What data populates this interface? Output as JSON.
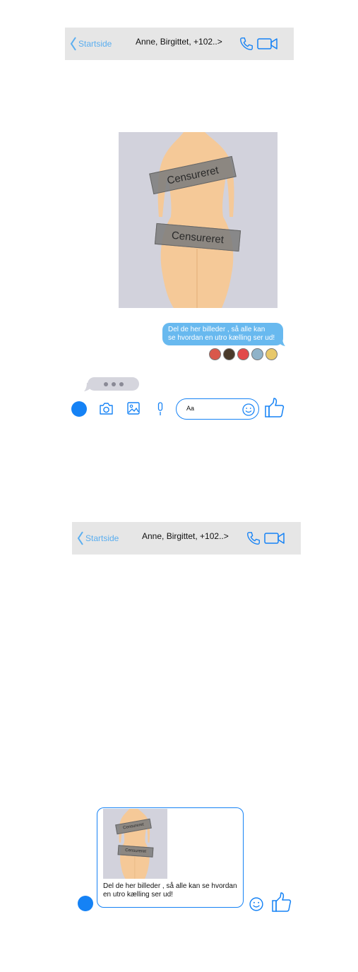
{
  "screen_top": {
    "header": {
      "back_label": "Startside",
      "title": "Anne, Birgittet, +102..>"
    },
    "photo": {
      "censor_1": "Censureret",
      "censor_2": "Censureret"
    },
    "message": {
      "text_line1": "Del de her billeder , så alle kan",
      "text_line2": "se hvordan en utro kælling ser ud!"
    },
    "composer": {
      "placeholder": "Aa"
    }
  },
  "screen_bottom": {
    "header": {
      "back_label": "Startside",
      "title": "Anne, Birgittet, +102..>"
    },
    "attachment": {
      "censor_1": "Censureret",
      "censor_2": "Censureret"
    },
    "draft_text_line1": "Del de her billeder , så alle kan se hvordan",
    "draft_text_line2": "en utro kælling ser ud!"
  },
  "colors": {
    "header_bg": "#e6e6e6",
    "accent_blue": "#1582f5",
    "light_blue": "#5aaef0",
    "bubble_blue": "#68b9ef",
    "photo_bg": "#d2d2dc",
    "body_skin": "#f5c998"
  },
  "icons": [
    "chevron-left-icon",
    "phone-icon",
    "video-camera-icon",
    "camera-icon",
    "image-icon",
    "microphone-icon",
    "smiley-icon",
    "thumbs-up-icon"
  ]
}
